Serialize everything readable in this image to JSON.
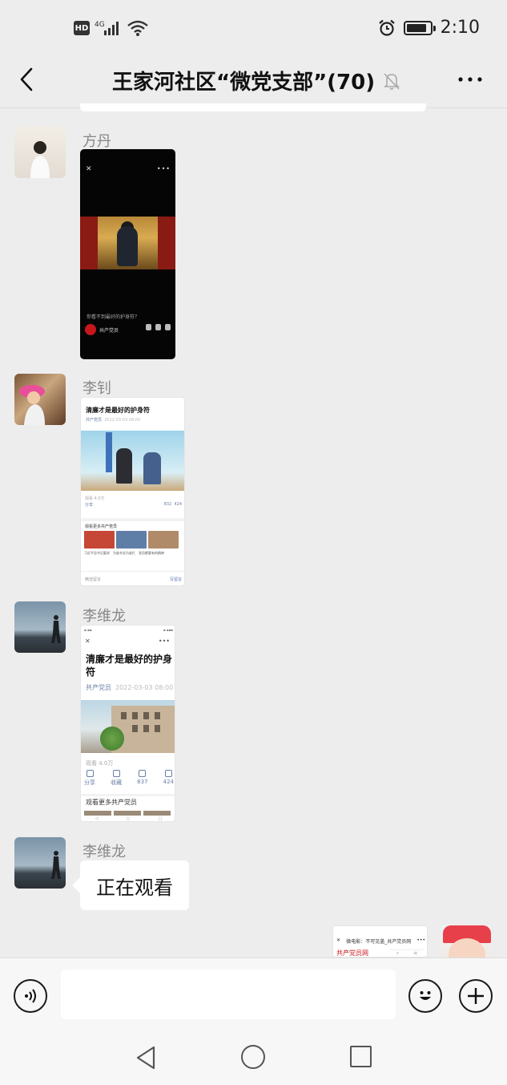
{
  "status_bar": {
    "hd_badge": "HD",
    "network": "4G",
    "time": "2:10"
  },
  "header": {
    "title": "王家河社区“微党支部”(70)",
    "back_icon": "chevron-left-icon",
    "mute_icon": "bell-off-icon",
    "more_icon": "more-horizontal-icon"
  },
  "messages": [
    {
      "sender": "方丹",
      "type": "video",
      "video": {
        "caption": "你看不到最好的护身符？",
        "account": "共产党员"
      }
    },
    {
      "sender": "李钊",
      "type": "article",
      "article": {
        "title": "清廉才是最好的护身符",
        "source": "共产党员",
        "date": "2022-03-03 08:00",
        "reads": "观看 4.0万",
        "share_label": "分享",
        "likes": "832",
        "stars": "424",
        "more_label": "观看更多共产党员",
        "thumb_captions": [
          "习近平总书记要求",
          "为谁辛苦为谁忙",
          "党员都要有的精神"
        ],
        "footer_left": "精选留言",
        "footer_right": "写留言"
      }
    },
    {
      "sender": "李维龙",
      "type": "screenshot",
      "screenshot": {
        "title": "清廉才是最好的护身符",
        "source": "共产党员",
        "date": "2022-03-03 08:00",
        "reads": "观看 4.0万",
        "actions": [
          {
            "label": "分享"
          },
          {
            "label": "收藏"
          },
          {
            "label": "837"
          },
          {
            "label": "424"
          }
        ],
        "more_label": "观看更多共产党员"
      }
    },
    {
      "sender": "李维龙",
      "type": "text",
      "text": "正在观看"
    }
  ],
  "outgoing": {
    "card_title": "微电影：不可见盖_共产党员网",
    "card_logo": "共产党员网"
  },
  "input_bar": {
    "placeholder": "",
    "voice_icon": "voice-icon",
    "emoji_icon": "emoji-icon",
    "plus_icon": "plus-icon"
  },
  "system_nav": {
    "back_icon": "triangle-back-icon",
    "home_icon": "circle-home-icon",
    "recent_icon": "square-recent-icon"
  }
}
